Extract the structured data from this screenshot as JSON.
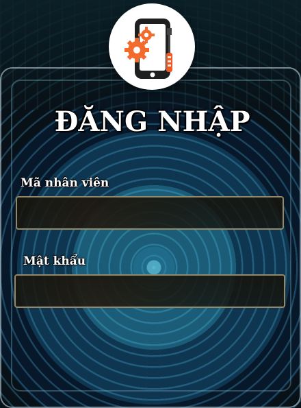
{
  "title": "ĐĂNG NHẬP",
  "logo": {
    "icon": "mobile-repair-icon",
    "accent_color": "#f05a22",
    "gear_color": "#f26b2c"
  },
  "form": {
    "employee": {
      "label": "Mã nhân viên",
      "value": "",
      "placeholder": ""
    },
    "password": {
      "label": "Mật khẩu",
      "value": "",
      "placeholder": ""
    }
  },
  "colors": {
    "title": "#ffffff",
    "input_border": "#958866",
    "background_glow": "#5bdcff"
  }
}
